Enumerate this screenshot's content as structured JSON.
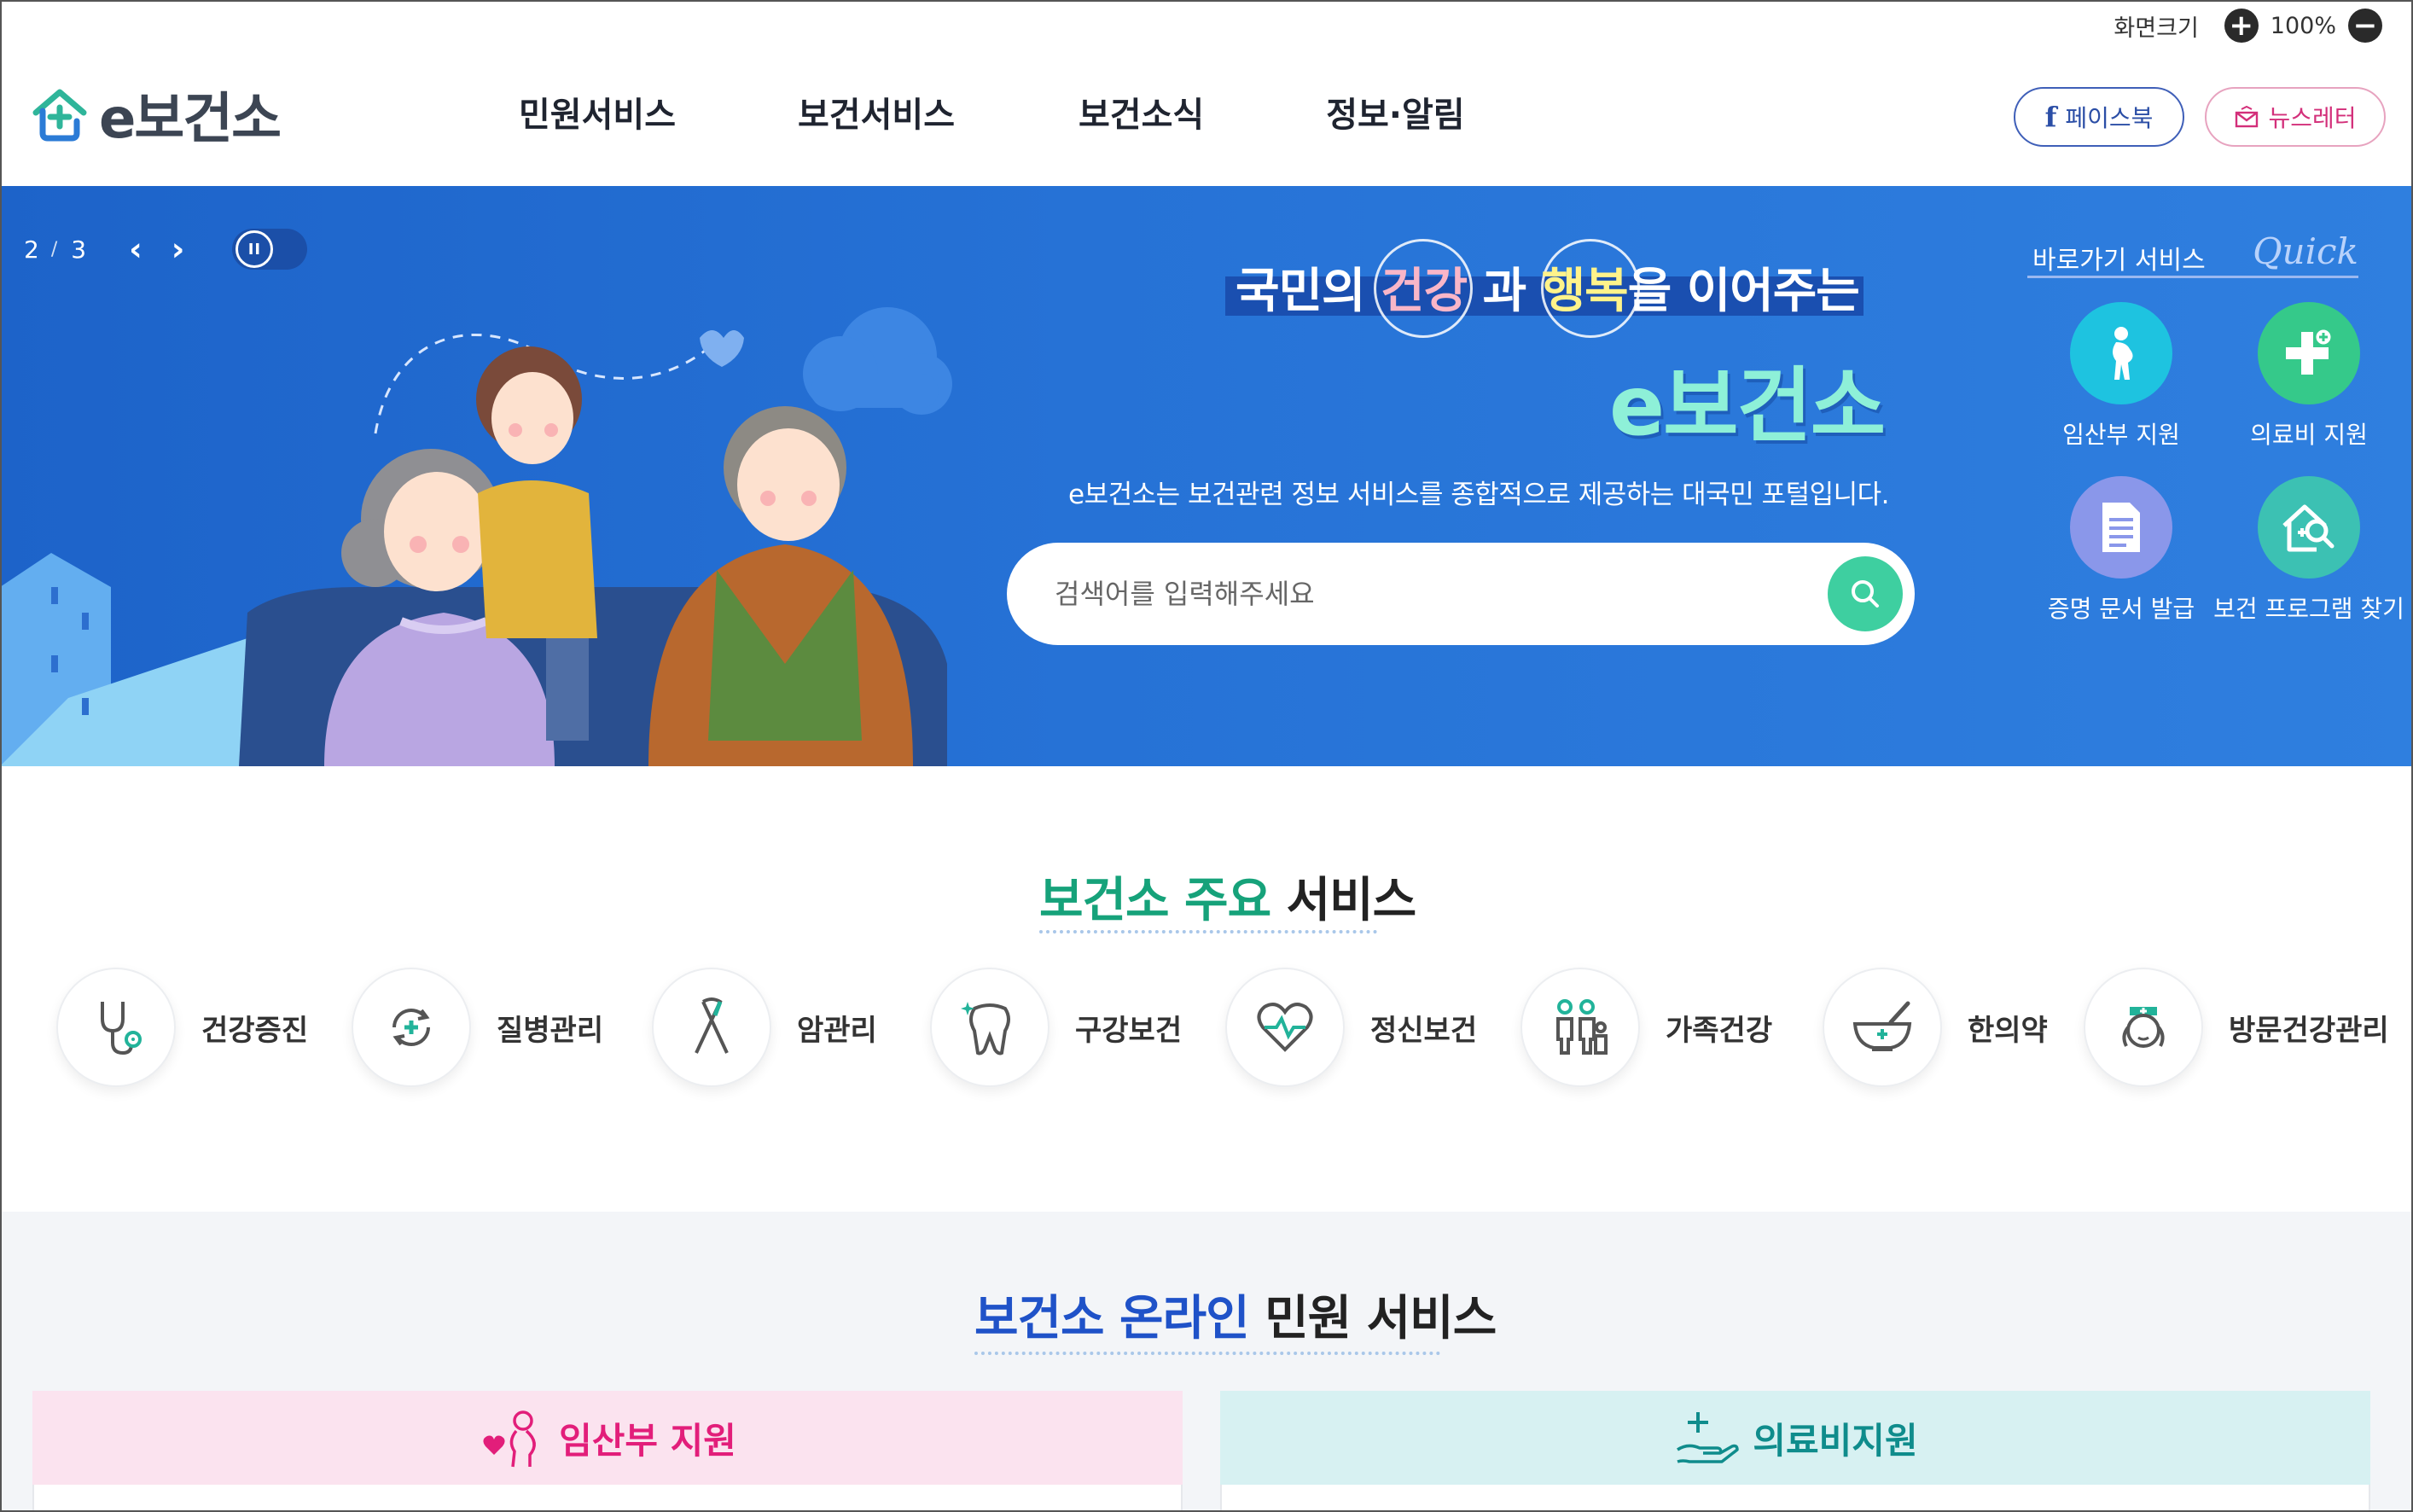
{
  "utility": {
    "zoom_label": "화면크기",
    "zoom_in": "+",
    "zoom_value": "100%",
    "zoom_out": "−"
  },
  "header": {
    "logo_text": "e보건소",
    "nav": [
      "민원서비스",
      "보건서비스",
      "보건소식",
      "정보·알림"
    ],
    "facebook": "페이스북",
    "newsletter": "뉴스레터"
  },
  "hero": {
    "slide_current": "2",
    "slide_sep": "/",
    "slide_total": "3",
    "prev": "‹",
    "next": "›",
    "pause": "II",
    "headline_pre": "국민의",
    "headline_hl1": "건강",
    "headline_mid": "과",
    "headline_hl2": "행복",
    "headline_post": "을 이어주는",
    "title": "e보건소",
    "description": "e보건소는 보건관련 정보 서비스를 종합적으로 제공하는 대국민 포털입니다.",
    "search_placeholder": "검색어를 입력해주세요"
  },
  "quick": {
    "title": "바로가기 서비스",
    "script": "Quick",
    "items": [
      {
        "label": "임산부 지원",
        "icon": "pregnant-icon",
        "color": "#1ec3e0"
      },
      {
        "label": "의료비 지원",
        "icon": "medical-plus-icon",
        "color": "#35c98a"
      },
      {
        "label": "증명 문서 발급",
        "icon": "document-icon",
        "color": "#8a97ea"
      },
      {
        "label": "보건 프로그램 찾기",
        "icon": "program-search-icon",
        "color": "#3cc1b3"
      }
    ]
  },
  "main_services": {
    "title_accent": "보건소 주요",
    "title_rest": "서비스",
    "items": [
      {
        "label": "건강증진",
        "icon": "stethoscope-icon"
      },
      {
        "label": "질병관리",
        "icon": "disease-cycle-icon"
      },
      {
        "label": "암관리",
        "icon": "cancer-ribbon-icon"
      },
      {
        "label": "구강보건",
        "icon": "tooth-icon"
      },
      {
        "label": "정신보건",
        "icon": "heart-pulse-icon"
      },
      {
        "label": "가족건강",
        "icon": "family-icon"
      },
      {
        "label": "한의약",
        "icon": "mortar-bowl-icon"
      },
      {
        "label": "방문건강관리",
        "icon": "nurse-icon"
      }
    ]
  },
  "online_services": {
    "title_accent": "보건소 온라인",
    "title_rest": "민원 서비스",
    "cards": [
      {
        "label": "임산부 지원",
        "icon": "pregnant-heart-icon"
      },
      {
        "label": "의료비지원",
        "icon": "hand-plus-icon"
      }
    ]
  },
  "colors": {
    "hero_blue": "#2672d6",
    "accent_green": "#16a27a",
    "accent_blue": "#1f52c8",
    "pink": "#e21e7a",
    "teal": "#0f8c8c"
  }
}
